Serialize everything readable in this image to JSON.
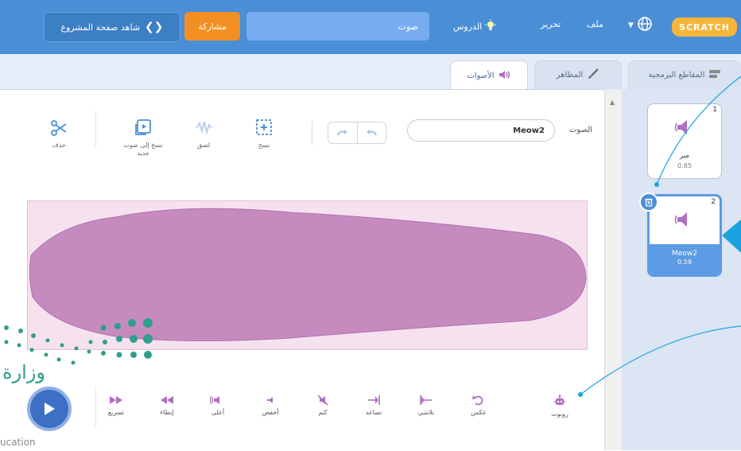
{
  "menu": {
    "file": "ملف",
    "edit": "تحرير",
    "tutorials": "الدروس",
    "logo": "SCRATCH"
  },
  "header": {
    "project_title": "صوت",
    "share": "مشاركة",
    "see_project_page": "شاهد صفحة المشروع"
  },
  "tabs": {
    "code": "المقاطع البرمجية",
    "costumes": "المظاهر",
    "sounds": "الأصوات"
  },
  "editor": {
    "sound_label": "الصوت",
    "sound_name": "Meow2",
    "tools": {
      "copy_to_new": "نسخ إلى صوت جديد",
      "copy": "نسخ",
      "paste": "لصق",
      "delete": "حذف"
    },
    "effects": {
      "faster": "تسريع",
      "slower": "إبطاء",
      "louder": "أعلى",
      "softer": "أخفض",
      "mute": "كتم",
      "fade_in": "تصاعد",
      "fade_out": "تلاشي",
      "reverse": "عكس",
      "robot": "روبوت"
    }
  },
  "sounds": [
    {
      "index": "1",
      "name": "مير",
      "duration": "0.85"
    },
    {
      "index": "2",
      "name": "Meow2",
      "duration": "0.59"
    }
  ],
  "watermark": {
    "arabic": "وزارة",
    "english": "ucation"
  },
  "colors": {
    "topbar": "#4a8fd6",
    "share": "#f28f22",
    "waveform": "#c58bbf",
    "selected": "#5b9be3"
  }
}
